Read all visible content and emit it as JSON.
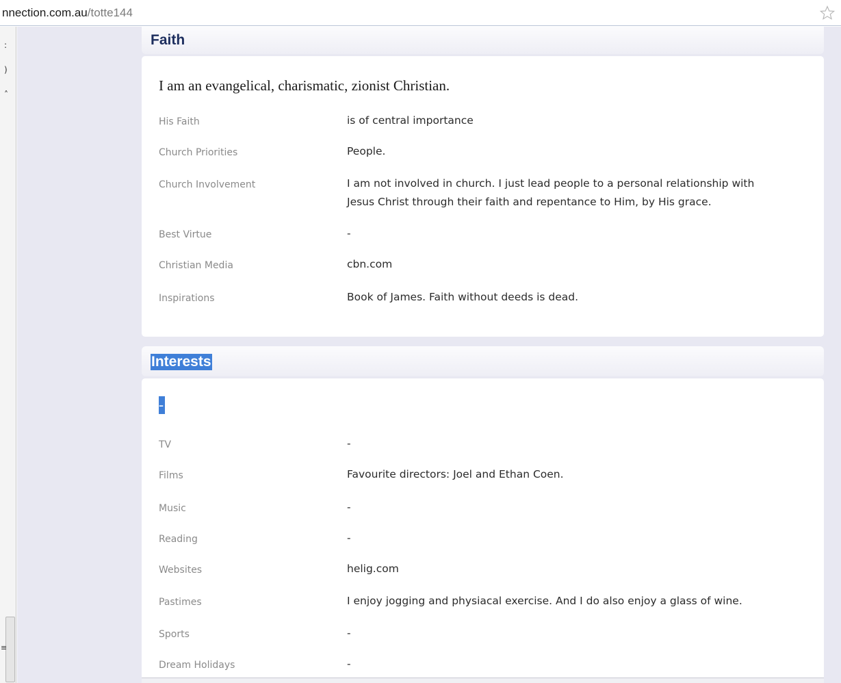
{
  "browser": {
    "url_domain": "nnection.com.au",
    "url_path": "/totte144"
  },
  "gutter": {
    "glyphs": [
      ":",
      ")",
      "˄",
      "≡"
    ]
  },
  "faith": {
    "title": "Faith",
    "lead": "I am an evangelical, charismatic, zionist Christian.",
    "rows": [
      {
        "label": "His Faith",
        "value": "is of central importance"
      },
      {
        "label": "Church Priorities",
        "value": "People."
      },
      {
        "label": "Church Involvement",
        "value": "I am not involved in church. I just lead people to a personal relationship with Jesus Christ through their faith and repentance to Him, by His grace."
      },
      {
        "label": "Best Virtue",
        "value": "-"
      },
      {
        "label": "Christian Media",
        "value": "cbn.com"
      },
      {
        "label": "Inspirations",
        "value": "Book of James. Faith without deeds is dead."
      }
    ]
  },
  "interests": {
    "title": "Interests",
    "lead": "-",
    "rows": [
      {
        "label": "TV",
        "value": "-"
      },
      {
        "label": "Films",
        "value": "Favourite directors: Joel and Ethan Coen."
      },
      {
        "label": "Music",
        "value": "-"
      },
      {
        "label": "Reading",
        "value": "-"
      },
      {
        "label": "Websites",
        "value": "helig.com"
      },
      {
        "label": "Pastimes",
        "value": "I enjoy jogging and physiacal exercise. And I do also enjoy a glass of wine."
      },
      {
        "label": "Sports",
        "value": "-"
      },
      {
        "label": "Dream Holidays",
        "value": "-"
      }
    ]
  }
}
